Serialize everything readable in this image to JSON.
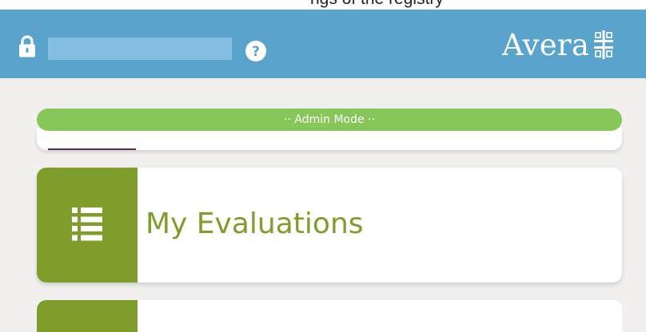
{
  "top_strip": {
    "text": "ngs of the registry"
  },
  "header": {
    "lock_icon": "lock-icon",
    "help_icon": "question-circle-icon",
    "brand_name": "Avera",
    "brand_mark": "avera-cross-icon",
    "colors": {
      "header_bg": "#5aa3cc",
      "field_bg": "#83bde0"
    }
  },
  "admin_bar": {
    "label": "·· Admin Mode ··",
    "color": "#88c65a"
  },
  "menu": {
    "items": [
      {
        "label": "My Evaluations",
        "icon": "list-icon",
        "accent": "#7f9d2b"
      }
    ]
  }
}
